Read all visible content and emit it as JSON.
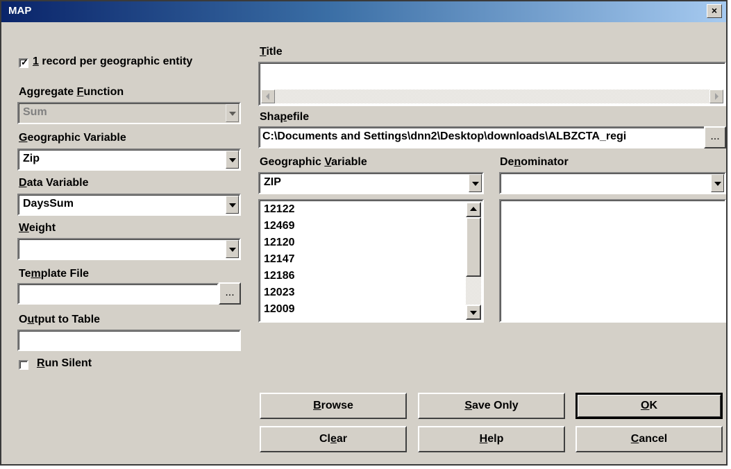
{
  "window": {
    "title": "MAP",
    "close_label": "×"
  },
  "left": {
    "one_record": {
      "checked": true,
      "pre": "",
      "ul": "1",
      "post": " record per geographic entity"
    },
    "aggregate_function": {
      "pre": "Aggregate ",
      "ul": "F",
      "post": "unction",
      "value": "Sum",
      "disabled": true
    },
    "geographic_variable": {
      "pre": "",
      "ul": "G",
      "post": "eographic Variable",
      "value": "Zip"
    },
    "data_variable": {
      "pre": "",
      "ul": "D",
      "post": "ata Variable",
      "value": "DaysSum"
    },
    "weight": {
      "pre": "",
      "ul": "W",
      "post": "eight",
      "value": ""
    },
    "template_file": {
      "pre": "Te",
      "ul": "m",
      "post": "plate File",
      "value": "",
      "browse_label": "..."
    },
    "output_to_table": {
      "pre": "O",
      "ul": "u",
      "post": "tput to Table",
      "value": ""
    },
    "run_silent": {
      "checked": false,
      "pre": "",
      "ul": "R",
      "post": "un Silent"
    }
  },
  "right": {
    "title": {
      "pre": "",
      "ul": "T",
      "post": "itle",
      "value": ""
    },
    "shapefile": {
      "pre": "Sha",
      "ul": "p",
      "post": "efile",
      "value": "C:\\Documents and Settings\\dnn2\\Desktop\\downloads\\ALBZCTA_regi",
      "browse_label": "..."
    },
    "geographic_variable": {
      "pre": "Geographic ",
      "ul": "V",
      "post": "ariable",
      "value": "ZIP"
    },
    "denominator": {
      "pre": "De",
      "ul": "n",
      "post": "ominator",
      "value": ""
    },
    "geo_values": [
      "12122",
      "12469",
      "12120",
      "12147",
      "12186",
      "12023",
      "12009"
    ]
  },
  "buttons": {
    "browse": {
      "pre": "",
      "ul": "B",
      "post": "rowse"
    },
    "save_only": {
      "pre": "",
      "ul": "S",
      "post": "ave Only"
    },
    "ok": {
      "pre": "",
      "ul": "O",
      "post": "K"
    },
    "clear": {
      "pre": "Cl",
      "ul": "e",
      "post": "ar"
    },
    "help": {
      "pre": "",
      "ul": "H",
      "post": "elp"
    },
    "cancel": {
      "pre": "",
      "ul": "C",
      "post": "ancel"
    }
  }
}
